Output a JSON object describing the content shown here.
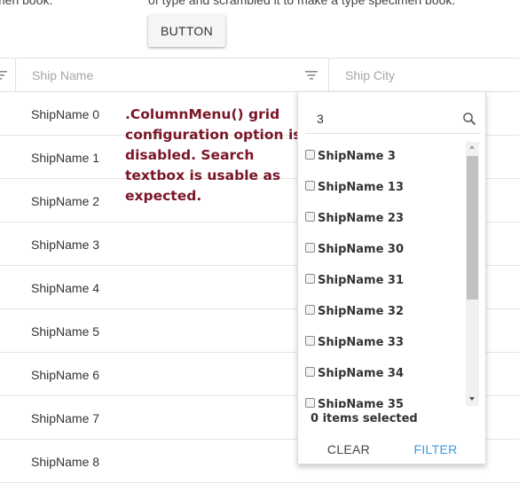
{
  "header_text": {
    "left": "men book.",
    "right": "of type and scrambled it to make a type specimen book."
  },
  "top_button": {
    "label": "BUTTON"
  },
  "grid": {
    "columns": [
      {
        "id": "shipname",
        "label": "Ship Name",
        "icon": "filter-icon"
      },
      {
        "id": "shipcity",
        "label": "Ship City"
      }
    ],
    "rows": [
      {
        "ship_name": "ShipName 0",
        "ship_city": ""
      },
      {
        "ship_name": "ShipName 1",
        "ship_city": ""
      },
      {
        "ship_name": "ShipName 2",
        "ship_city": ""
      },
      {
        "ship_name": "ShipName 3",
        "ship_city": ""
      },
      {
        "ship_name": "ShipName 4",
        "ship_city": ""
      },
      {
        "ship_name": "ShipName 5",
        "ship_city": ""
      },
      {
        "ship_name": "ShipName 6",
        "ship_city": ""
      },
      {
        "ship_name": "ShipName 7",
        "ship_city": ""
      },
      {
        "ship_name": "ShipName 8",
        "ship_city": ""
      }
    ]
  },
  "annotation": {
    "text": ".ColumnMenu() grid configuration option is disabled. Search textbox is usable as expected.",
    "color": "#7a1526"
  },
  "filter_popup": {
    "search": {
      "value": "3",
      "icon": "search-icon"
    },
    "options": [
      {
        "label": "ShipName 3",
        "checked": false
      },
      {
        "label": "ShipName 13",
        "checked": false
      },
      {
        "label": "ShipName 23",
        "checked": false
      },
      {
        "label": "ShipName 30",
        "checked": false
      },
      {
        "label": "ShipName 31",
        "checked": false
      },
      {
        "label": "ShipName 32",
        "checked": false
      },
      {
        "label": "ShipName 33",
        "checked": false
      },
      {
        "label": "ShipName 34",
        "checked": false
      },
      {
        "label": "ShipName 35",
        "checked": false
      }
    ],
    "selected_count_text": "0 items selected",
    "clear_label": "CLEAR",
    "filter_label": "FILTER",
    "accent_color": "#3d9ae0"
  }
}
